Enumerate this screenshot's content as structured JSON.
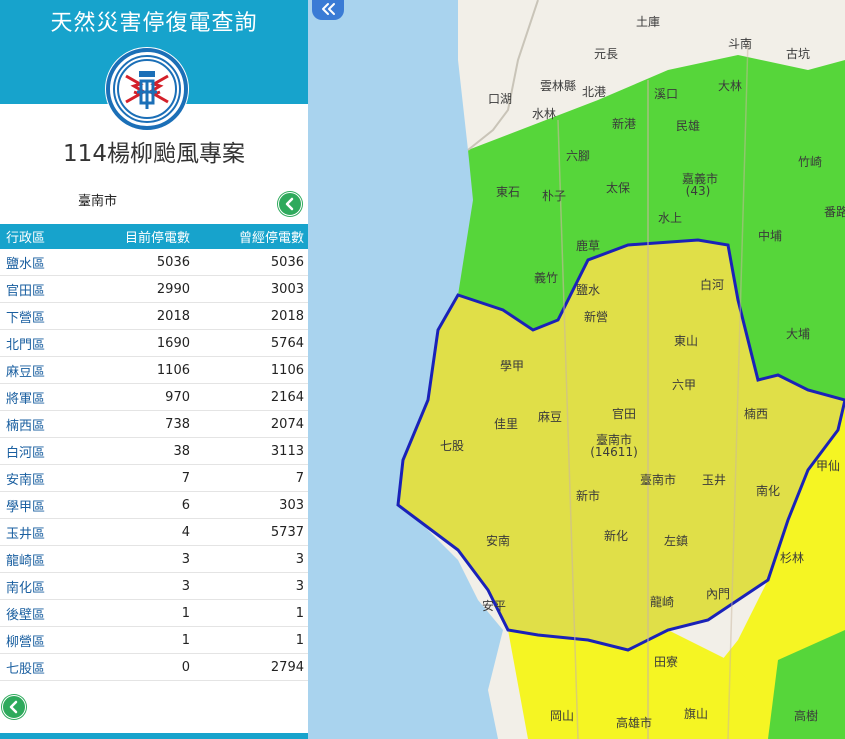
{
  "app_title": "天然災害停復電查詢",
  "project_title": "114楊柳颱風專案",
  "city": "臺南市",
  "table": {
    "headers": [
      "行政區",
      "目前停電數",
      "曾經停電數"
    ],
    "rows": [
      {
        "district": "鹽水區",
        "current": "5036",
        "ever": "5036"
      },
      {
        "district": "官田區",
        "current": "2990",
        "ever": "3003"
      },
      {
        "district": "下營區",
        "current": "2018",
        "ever": "2018"
      },
      {
        "district": "北門區",
        "current": "1690",
        "ever": "5764"
      },
      {
        "district": "麻豆區",
        "current": "1106",
        "ever": "1106"
      },
      {
        "district": "將軍區",
        "current": "970",
        "ever": "2164"
      },
      {
        "district": "楠西區",
        "current": "738",
        "ever": "2074"
      },
      {
        "district": "白河區",
        "current": "38",
        "ever": "3113"
      },
      {
        "district": "安南區",
        "current": "7",
        "ever": "7"
      },
      {
        "district": "學甲區",
        "current": "6",
        "ever": "303"
      },
      {
        "district": "玉井區",
        "current": "4",
        "ever": "5737"
      },
      {
        "district": "龍崎區",
        "current": "3",
        "ever": "3"
      },
      {
        "district": "南化區",
        "current": "3",
        "ever": "3"
      },
      {
        "district": "後壁區",
        "current": "1",
        "ever": "1"
      },
      {
        "district": "柳營區",
        "current": "1",
        "ever": "1"
      },
      {
        "district": "七股區",
        "current": "0",
        "ever": "2794"
      }
    ]
  },
  "map": {
    "tainan_label": "臺南市",
    "tainan_count": "(14611)",
    "chiayi_label": "嘉義市",
    "chiayi_count": "(43)",
    "places": [
      "天然災害停復電查詢",
      "土庫",
      "斗南",
      "古坑",
      "元長",
      "雲林縣",
      "北港",
      "口湖",
      "水林",
      "溪口",
      "大林",
      "民雄",
      "新港",
      "六腳",
      "竹崎",
      "東石",
      "朴子",
      "太保",
      "嘉義市",
      "水上",
      "中埔",
      "番路",
      "鹿草",
      "義竹",
      "白河",
      "鹽水",
      "新營",
      "東山",
      "大埔",
      "六甲",
      "學甲",
      "麻豆",
      "官田",
      "楠西",
      "佳里",
      "七股",
      "玉井",
      "甲仙",
      "新市",
      "南化",
      "臺南市",
      "安南",
      "新化",
      "左鎮",
      "杉林",
      "安平",
      "內門",
      "龍崎",
      "田寮",
      "岡山",
      "高雄市",
      "旗山",
      "高樹"
    ],
    "colors": {
      "sea": "#a9d3ee",
      "land": "#f2efe8",
      "green": "#56d63a",
      "yellow": "#f5f523",
      "tainan": "#e0df48",
      "boundary": "#1a22b8"
    }
  }
}
